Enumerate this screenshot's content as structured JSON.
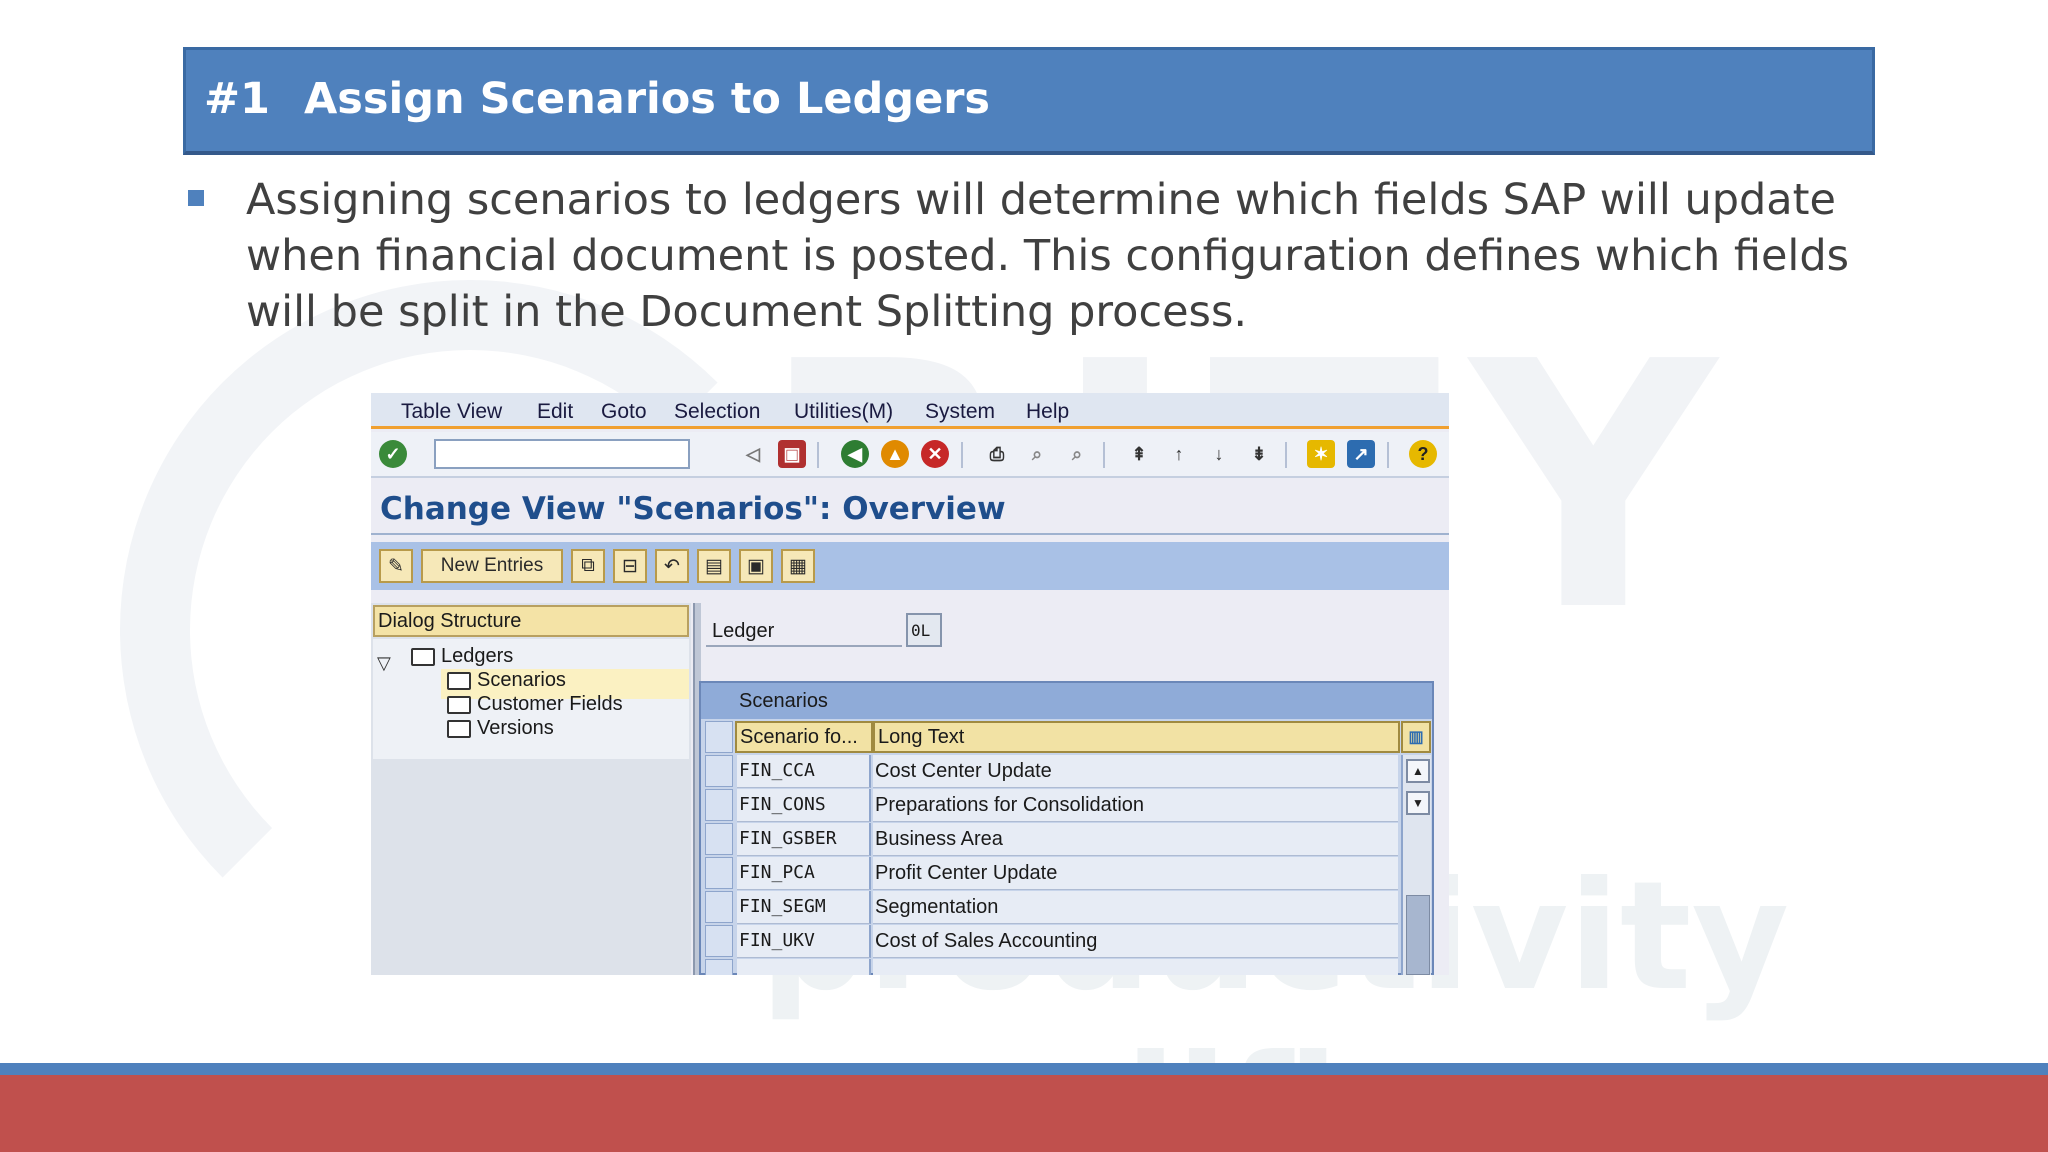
{
  "slide": {
    "number": "#1",
    "title": "Assign Scenarios to Ledgers",
    "bullet": "Assigning scenarios to ledgers will determine which fields SAP will update when financial document is posted. This configuration defines which fields will be split in the Document Splitting process."
  },
  "watermark": {
    "main": "RITY",
    "sub": "productivity amplifie"
  },
  "sap": {
    "menu": [
      "Table View",
      "Edit",
      "Goto",
      "Selection",
      "Utilities(M)",
      "System",
      "Help"
    ],
    "view_title": "Change View \"Scenarios\": Overview",
    "new_entries": "New Entries",
    "dialog_structure": {
      "header": "Dialog Structure",
      "items": [
        "Ledgers",
        "Scenarios",
        "Customer Fields",
        "Versions"
      ]
    },
    "ledger": {
      "label": "Ledger",
      "value": "0L"
    },
    "table": {
      "title": "Scenarios",
      "columns": [
        "Scenario fo...",
        "Long Text"
      ],
      "rows": [
        {
          "scenario": "FIN_CCA",
          "text": "Cost Center Update"
        },
        {
          "scenario": "FIN_CONS",
          "text": "Preparations for Consolidation"
        },
        {
          "scenario": "FIN_GSBER",
          "text": "Business Area"
        },
        {
          "scenario": "FIN_PCA",
          "text": "Profit Center Update"
        },
        {
          "scenario": "FIN_SEGM",
          "text": "Segmentation"
        },
        {
          "scenario": "FIN_UKV",
          "text": "Cost of Sales Accounting"
        }
      ]
    }
  },
  "colors": {
    "title_bar": "#4f81bd",
    "footer": "#c0504d"
  }
}
